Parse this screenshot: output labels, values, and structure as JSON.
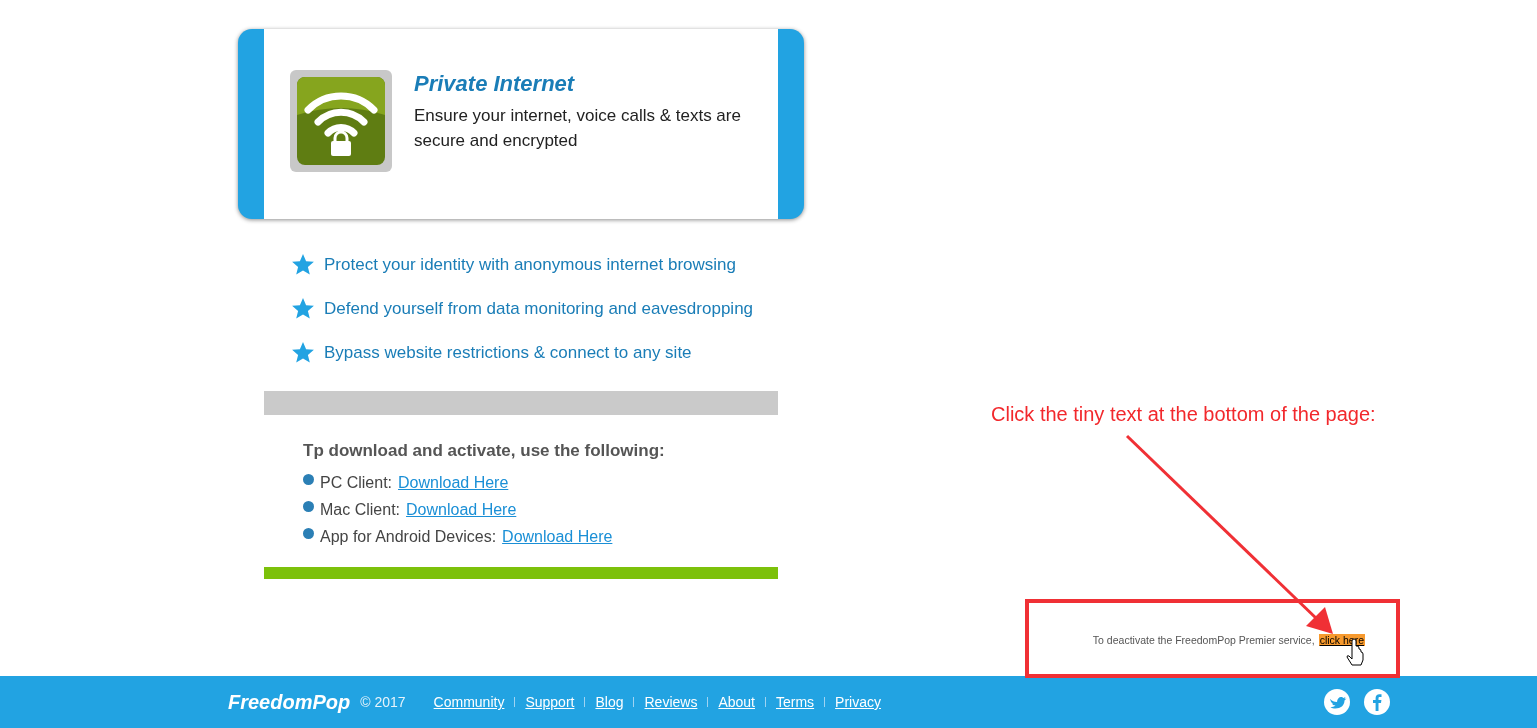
{
  "card": {
    "title": "Private Internet",
    "description": "Ensure your internet, voice calls & texts are secure and encrypted"
  },
  "features": [
    "Protect your identity with anonymous internet browsing",
    "Defend yourself from data monitoring and eavesdropping",
    "Bypass website restrictions & connect to any site"
  ],
  "download": {
    "heading": "Tp download and activate, use the following:",
    "items": [
      {
        "label": "PC Client:",
        "link": "Download Here"
      },
      {
        "label": "Mac Client:",
        "link": "Download Here"
      },
      {
        "label": "App for Android Devices:",
        "link": "Download Here"
      }
    ]
  },
  "deactivate": {
    "text": "To deactivate the FreedomPop Premier service,",
    "link": "click here"
  },
  "annotation": {
    "text": "Click the tiny text at the bottom of the page:"
  },
  "footer": {
    "logo": "FreedomPop",
    "copyright": "© 2017",
    "links": [
      "Community",
      "Support",
      "Blog",
      "Reviews",
      "About",
      "Terms",
      "Privacy"
    ]
  }
}
